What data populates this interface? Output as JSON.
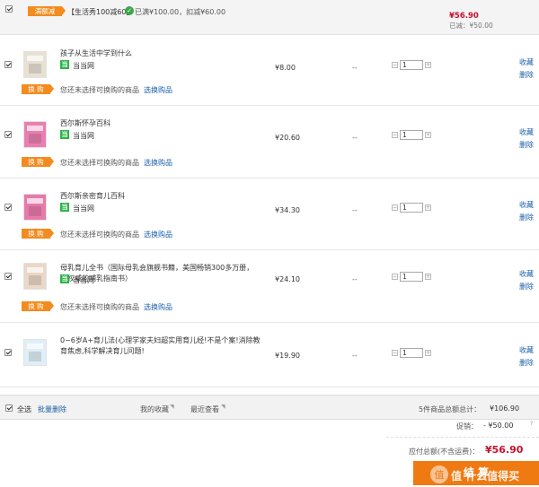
{
  "promo": {
    "tag": "满额减",
    "text": "【生活秀100减60】",
    "condition": "已满¥100.00，扣减¥60.00",
    "price": "¥56.90",
    "saved": "已减：¥50.00"
  },
  "items": [
    {
      "title": "孩子从生活中学到什么",
      "title2": "",
      "shop": "当当网",
      "price": "¥8.00",
      "discount": "--",
      "qty": "1",
      "action1": "收藏",
      "action2": "删除",
      "swap_tag": "换 购",
      "swap_text": "您还未选择可换购的商品",
      "swap_link": "选换购品",
      "cover": "#e8e1d3"
    },
    {
      "title": "西尔斯怀孕百科",
      "title2": "",
      "shop": "当当网",
      "price": "¥20.60",
      "discount": "--",
      "qty": "1",
      "action1": "收藏",
      "action2": "删除",
      "swap_tag": "换 购",
      "swap_text": "您还未选择可换购的商品",
      "swap_link": "选换购品",
      "cover": "#e97fb1"
    },
    {
      "title": "西尔斯亲密育儿百科",
      "title2": "",
      "shop": "当当网",
      "price": "¥34.30",
      "discount": "--",
      "qty": "1",
      "action1": "收藏",
      "action2": "删除",
      "swap_tag": "换 购",
      "swap_text": "您还未选择可换购的商品",
      "swap_link": "选换购品",
      "cover": "#e77aaa"
    },
    {
      "title": "母乳育儿全书（国际母乳会旗舰书籍，美国畅销300多万册，",
      "title2": "最权威的哺乳指南书）",
      "shop": "当当网",
      "price": "¥24.10",
      "discount": "--",
      "qty": "1",
      "action1": "收藏",
      "action2": "删除",
      "swap_tag": "换 购",
      "swap_text": "您还未选择可换购的商品",
      "swap_link": "选换购品",
      "cover": "#ead7c7"
    },
    {
      "title": "0~6岁A+育儿法(心理学家夫妇超实用育儿经!不是个案!消除教",
      "title2": "育焦虑,科学解决育儿问题!",
      "shop": "",
      "price": "¥19.90",
      "discount": "--",
      "qty": "1",
      "action1": "收藏",
      "action2": "删除",
      "swap_tag": "",
      "swap_text": "",
      "swap_link": "",
      "cover": "#dfeef7"
    }
  ],
  "footer": {
    "select_all": "全选",
    "batch_delete": "批量删除",
    "favorites": "我的收藏",
    "recent": "最近查看",
    "count_label": "5件商品总额总计：",
    "total": "¥106.90",
    "promo_label": "促销：",
    "promo_value": "- ¥50.00",
    "pay_label": "应付总额(不含运费)：",
    "pay_value": "¥56.90",
    "checkout": "结 算"
  },
  "watermark": "值 什么值得买",
  "colors": {
    "accent": "#f38b1f",
    "price_red": "#c8102e",
    "link_blue": "#1a5fa8",
    "shop_green": "#2db34a"
  }
}
